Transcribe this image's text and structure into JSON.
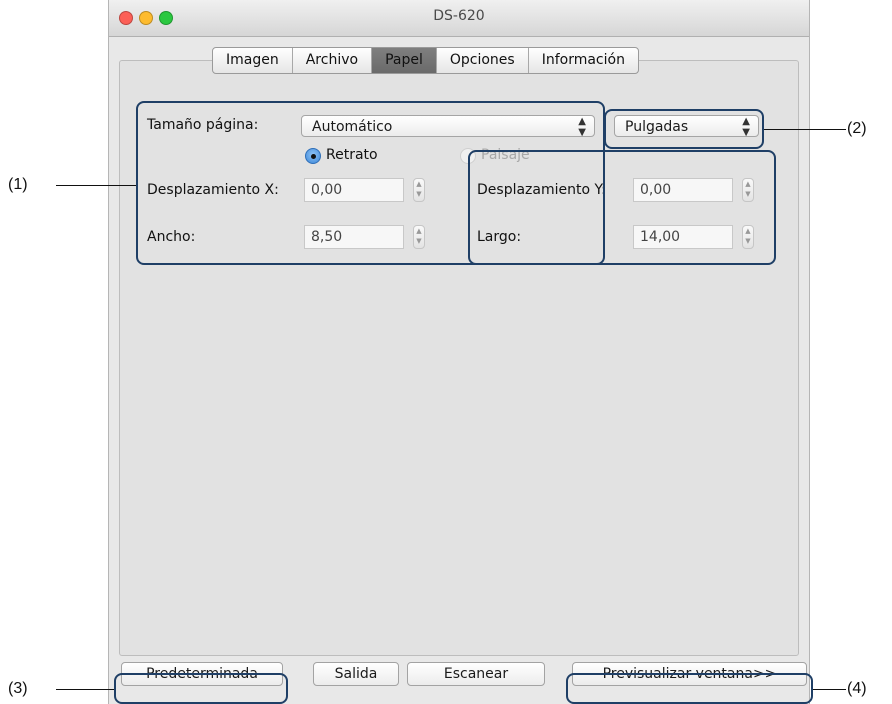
{
  "window": {
    "title": "DS-620"
  },
  "tabs": [
    {
      "label": "Imagen"
    },
    {
      "label": "Archivo"
    },
    {
      "label": "Papel",
      "active": true
    },
    {
      "label": "Opciones"
    },
    {
      "label": "Información"
    }
  ],
  "paper": {
    "page_size_label": "Tamaño página:",
    "page_size_value": "Automático",
    "units_value": "Pulgadas",
    "portrait_label": "Retrato",
    "landscape_label": "Paisaje",
    "offset_x_label": "Desplazamiento X:",
    "offset_x_value": "0,00",
    "offset_y_label": "Desplazamiento Y:",
    "offset_y_value": "0,00",
    "width_label": "Ancho:",
    "width_value": "8,50",
    "length_label": "Largo:",
    "length_value": "14,00"
  },
  "buttons": {
    "default": "Predeterminada",
    "exit": "Salida",
    "scan": "Escanear",
    "preview": "Previsualizar ventana>>"
  },
  "annotations": {
    "one": "(1)",
    "two": "(2)",
    "three": "(3)",
    "four": "(4)"
  },
  "icons": {
    "updown": "updown-arrows-icon",
    "stepper": "stepper-icon"
  },
  "colors": {
    "callout": "#1f3f66",
    "radio_on": "#3b86d8",
    "traffic_close": "#fc5f57",
    "traffic_min": "#fdbb2e",
    "traffic_max": "#2bc840"
  }
}
